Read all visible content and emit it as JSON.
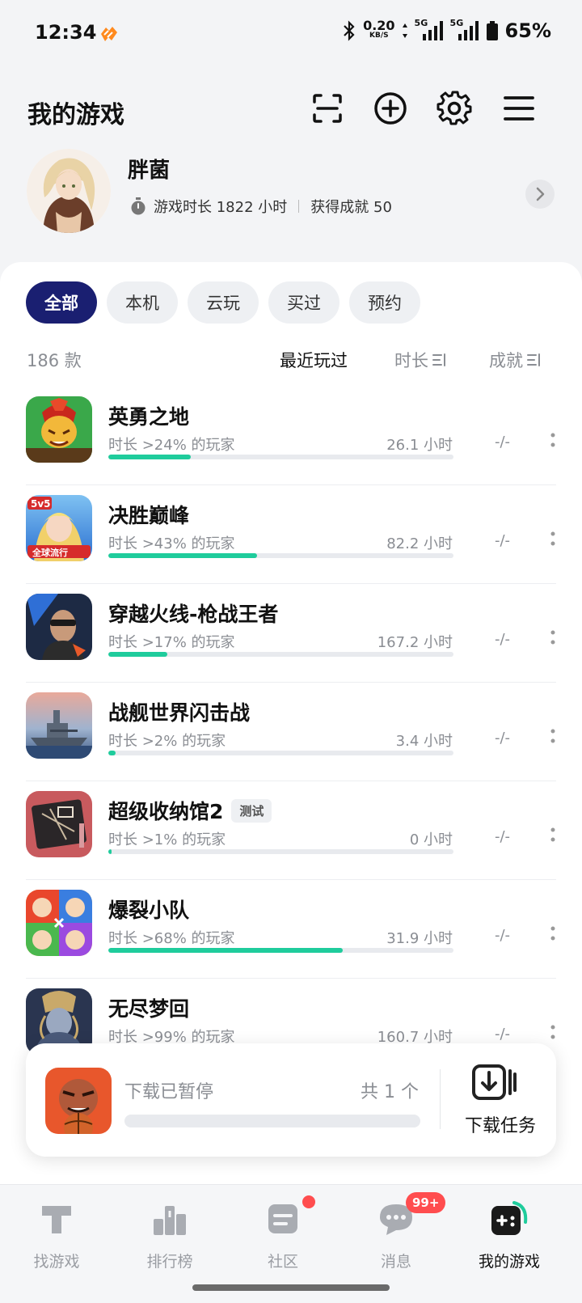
{
  "status": {
    "time": "12:34",
    "speed_value": "0.20",
    "speed_unit": "KB/S",
    "net1": "5G",
    "net2": "5G",
    "battery": "65%"
  },
  "header": {
    "title": "我的游戏",
    "icons": [
      "scan-icon",
      "add-icon",
      "settings-icon",
      "menu-icon"
    ]
  },
  "profile": {
    "name": "胖菌",
    "playtime_label": "游戏时长 1822 小时",
    "achievements_label": "获得成就 50"
  },
  "filters": {
    "tabs": [
      "全部",
      "本机",
      "云玩",
      "买过",
      "预约"
    ],
    "active_index": 0
  },
  "list_header": {
    "count": "186 款",
    "sort_recent": "最近玩过",
    "sort_duration": "时长",
    "sort_achievements": "成就"
  },
  "games": [
    {
      "name": "英勇之地",
      "tag": "",
      "pct_label": "时长 >24% 的玩家",
      "percentile": 24,
      "hours": "26.1 小时",
      "achv": "-/-"
    },
    {
      "name": "决胜巅峰",
      "tag": "",
      "pct_label": "时长 >43% 的玩家",
      "percentile": 43,
      "hours": "82.2 小时",
      "achv": "-/-"
    },
    {
      "name": "穿越火线-枪战王者",
      "tag": "",
      "pct_label": "时长 >17% 的玩家",
      "percentile": 17,
      "hours": "167.2 小时",
      "achv": "-/-"
    },
    {
      "name": "战舰世界闪击战",
      "tag": "",
      "pct_label": "时长 >2% 的玩家",
      "percentile": 2,
      "hours": "3.4 小时",
      "achv": "-/-"
    },
    {
      "name": "超级收纳馆2",
      "tag": "测试",
      "pct_label": "时长 >1% 的玩家",
      "percentile": 1,
      "hours": "0 小时",
      "achv": "-/-"
    },
    {
      "name": "爆裂小队",
      "tag": "",
      "pct_label": "时长 >68% 的玩家",
      "percentile": 68,
      "hours": "31.9 小时",
      "achv": "-/-"
    },
    {
      "name": "无尽梦回",
      "tag": "",
      "pct_label": "时长 >99% 的玩家",
      "percentile": 99,
      "hours": "160.7 小时",
      "achv": "-/-"
    }
  ],
  "download": {
    "status": "下载已暂停",
    "count": "共 1 个",
    "task_label": "下载任务",
    "progress": 0
  },
  "nav": {
    "items": [
      "找游戏",
      "排行榜",
      "社区",
      "消息",
      "我的游戏"
    ],
    "active_index": 4,
    "message_badge": "99+"
  },
  "colors": {
    "accent_navy": "#1a1f71",
    "progress_green": "#1fcc9c",
    "badge_red": "#ff4d4f"
  }
}
